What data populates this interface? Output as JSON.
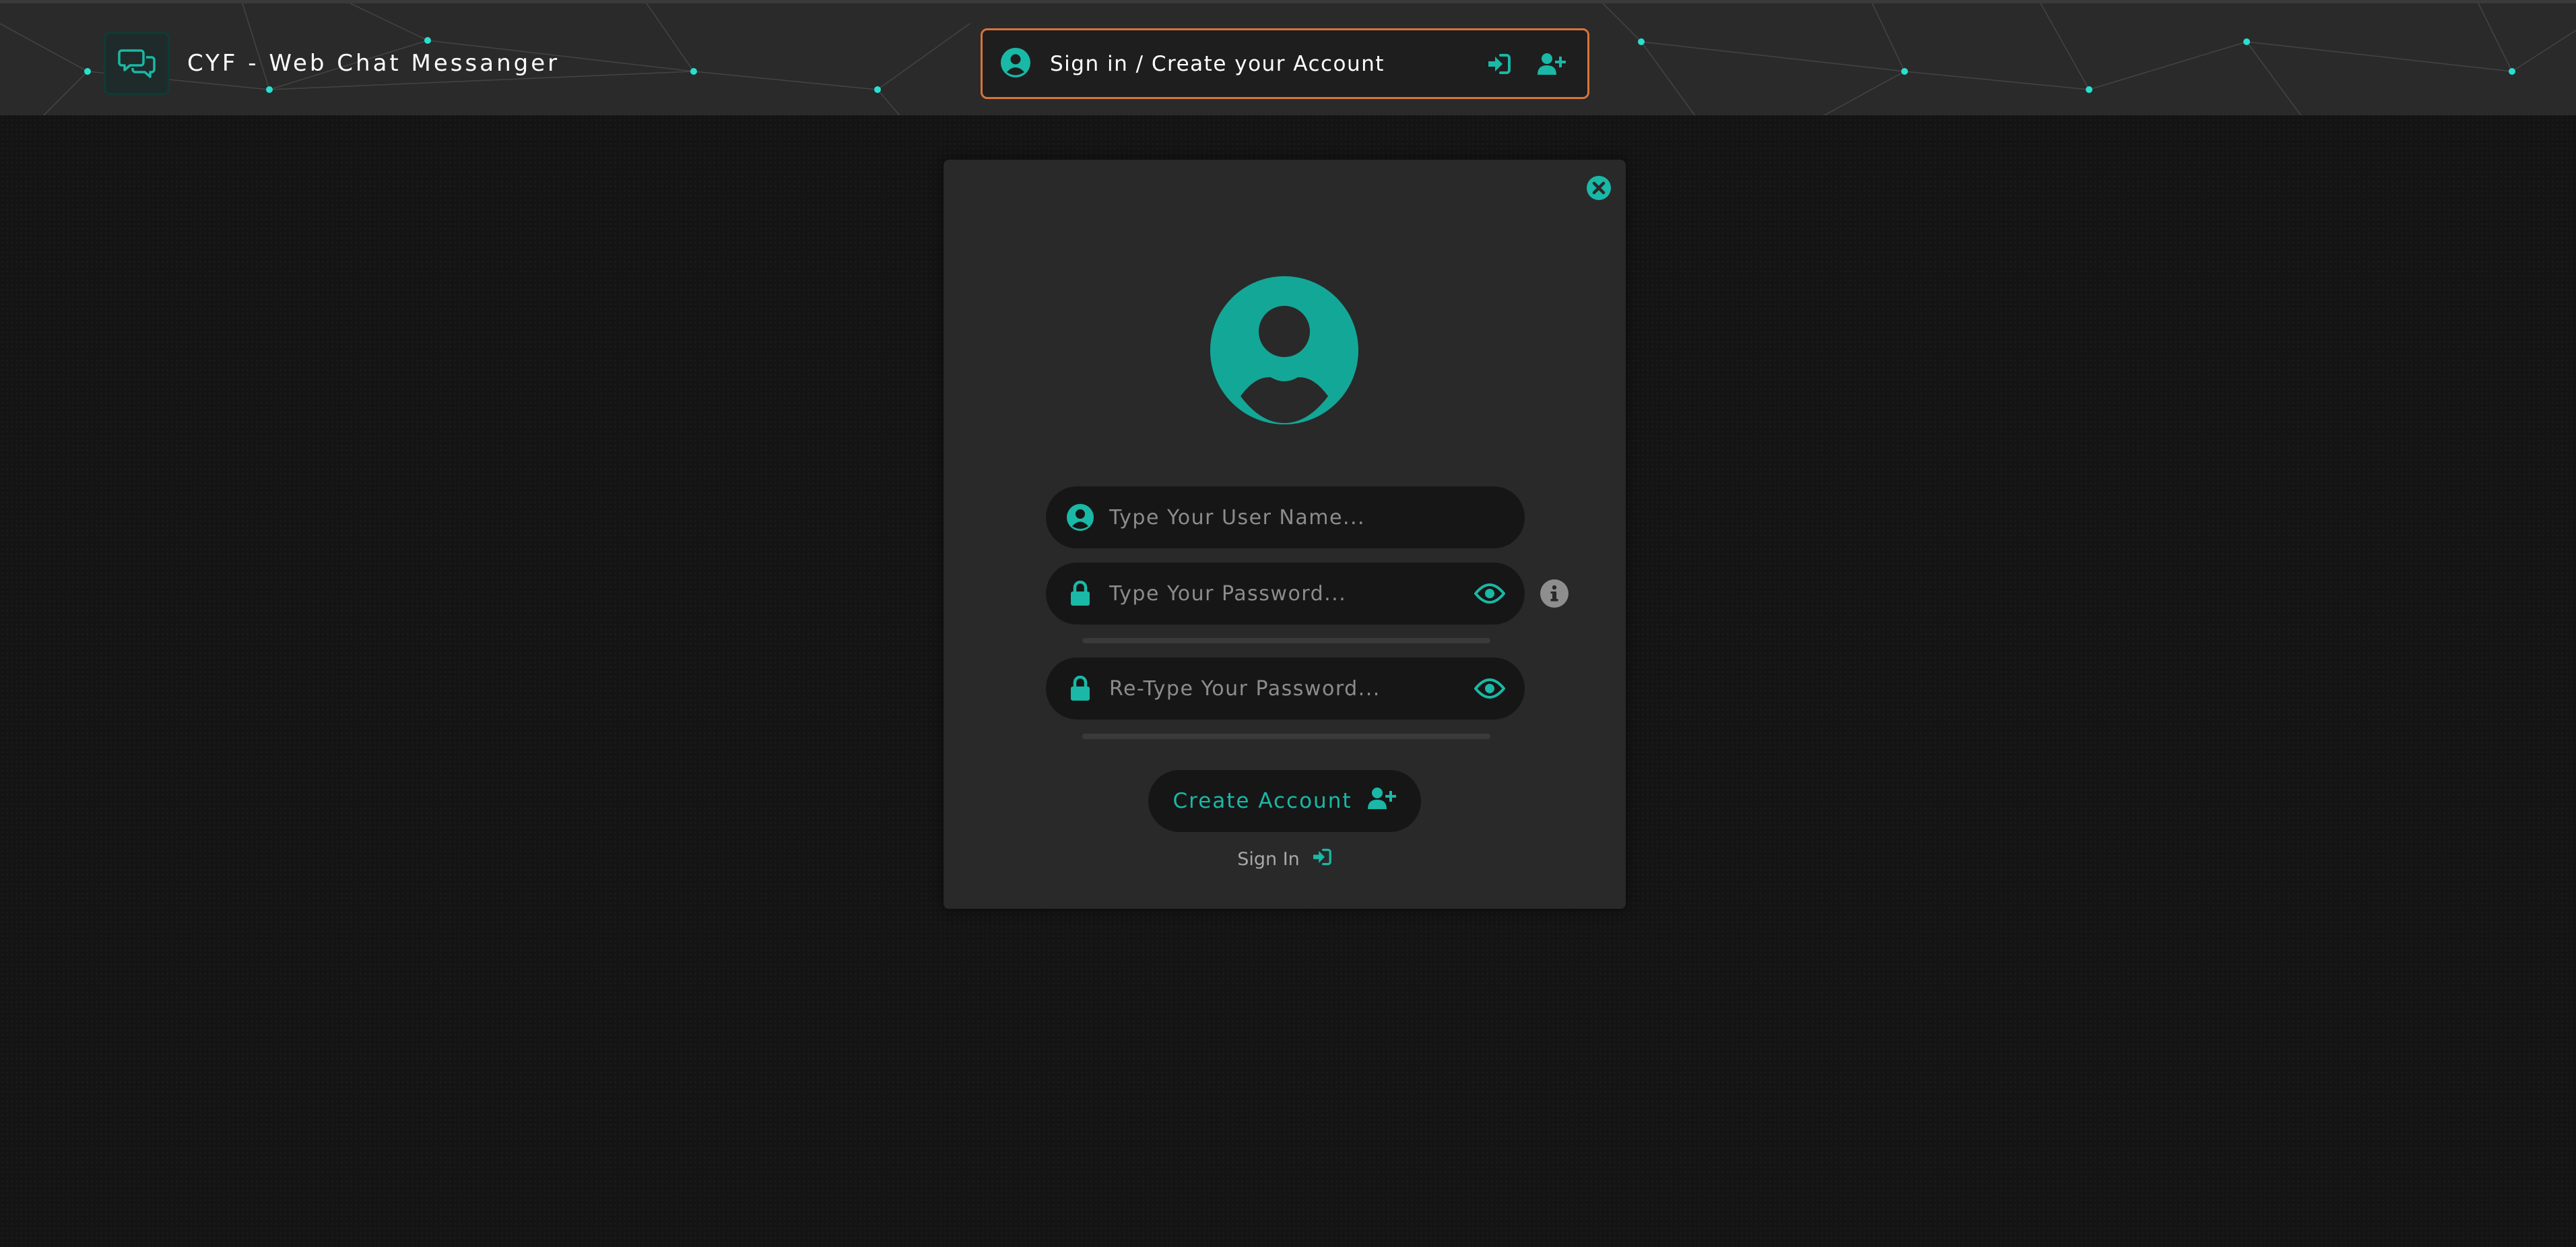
{
  "colors": {
    "accent": "#1ab8a6",
    "header_bg": "#2a2a2a",
    "modal_bg": "#292929",
    "field_bg": "#161616",
    "account_border": "#d9733c",
    "page_bg": "#141414"
  },
  "header": {
    "brand_icon": "chat-bubbles-icon",
    "title": "CYF - Web Chat Messanger",
    "account_bar": {
      "label": "Sign in / Create your Account",
      "user_icon": "user-circle-icon",
      "signin_icon": "sign-in-icon",
      "add_user_icon": "user-plus-icon"
    }
  },
  "modal": {
    "close_icon": "close-circle-icon",
    "avatar_icon": "user-circle-icon",
    "username": {
      "placeholder": "Type Your User Name...",
      "value": "",
      "icon": "user-circle-icon"
    },
    "password": {
      "placeholder": "Type Your Password...",
      "value": "",
      "icon": "lock-icon",
      "toggle_icon": "eye-icon"
    },
    "info_icon": "info-icon",
    "retype_password": {
      "placeholder": "Re-Type Your Password...",
      "value": "",
      "icon": "lock-icon",
      "toggle_icon": "eye-icon"
    },
    "create_button": {
      "label": "Create Account",
      "icon": "user-plus-icon"
    },
    "signin_link": {
      "label": "Sign In",
      "icon": "sign-in-icon"
    }
  }
}
